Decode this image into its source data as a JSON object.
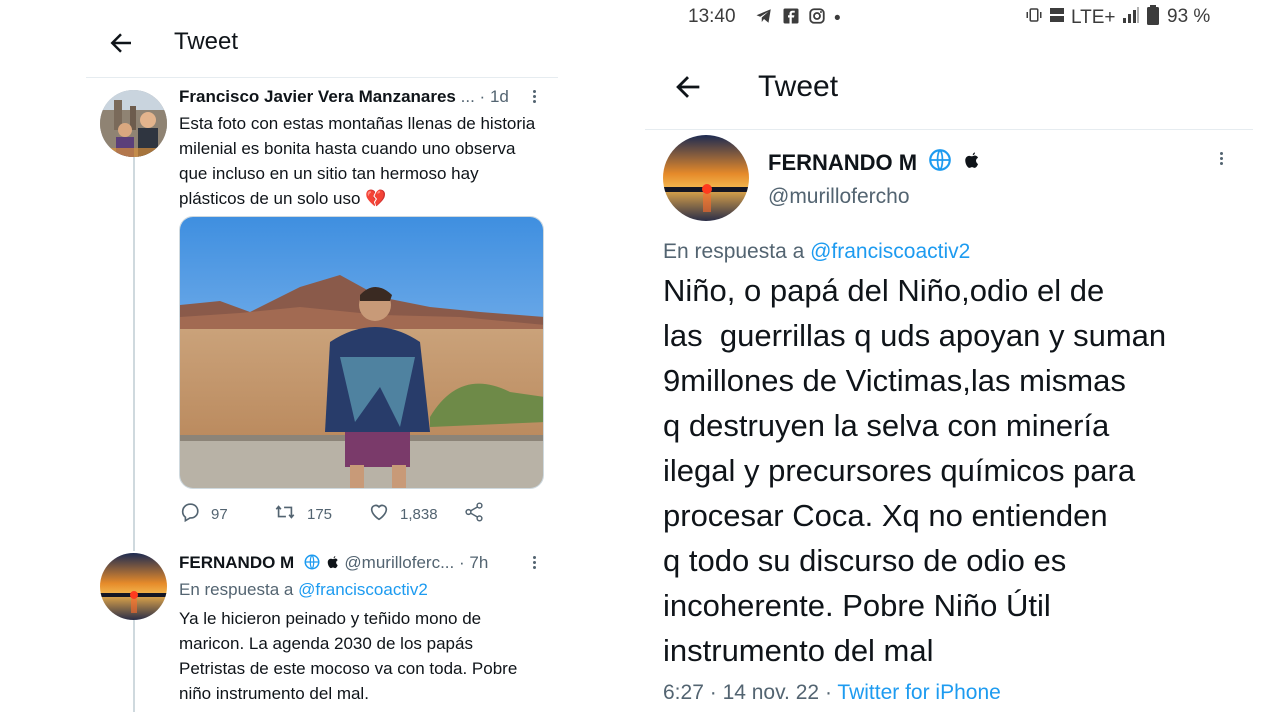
{
  "left": {
    "header": {
      "title": "Tweet"
    },
    "tweet1": {
      "name": "Francisco Javier Vera Manzanares",
      "ellipsis": "...",
      "dot": "·",
      "time": "1d",
      "text": "Esta foto con estas montañas llenas de historia milenial es bonita hasta cuando uno observa que incluso en un sitio tan hermoso hay plásticos de un solo uso 💔",
      "actions": {
        "replies": "97",
        "retweets": "175",
        "likes": "1,838"
      }
    },
    "tweet2": {
      "name": "FERNANDO M",
      "handle": "@murilloferc...",
      "dot": "·",
      "time": "7h",
      "reply_prefix": "En respuesta a",
      "reply_to": "@franciscoactiv2",
      "text": "Ya le hicieron peinado y teñido mono de maricon. La agenda 2030 de los papás Petristas de este mocoso va con toda. Pobre niño instrumento del mal."
    }
  },
  "right": {
    "status_bar": {
      "time": "13:40",
      "dot": "•",
      "network": "LTE+",
      "battery": "93 %"
    },
    "header": {
      "title": "Tweet"
    },
    "tweet": {
      "name": "FERNANDO M",
      "handle": "@murillofercho",
      "reply_prefix": "En respuesta a",
      "reply_to": "@franciscoactiv2",
      "text_lines": [
        "Niño, o papá del Niño,odio el de",
        "las  guerrillas q uds apoyan y suman",
        "9millones de Victimas,las mismas",
        "q destruyen la selva con minería",
        "ilegal y precursores químicos para",
        "procesar Coca. Xq no entienden",
        "q todo su discurso de odio es",
        "incoherente. Pobre Niño Útil",
        "instrumento del mal"
      ],
      "time": "6:27",
      "sep1": "·",
      "date": "14 nov. 22",
      "sep2": "·",
      "source": "Twitter for iPhone"
    }
  },
  "icons": {
    "back": "arrow-left-icon",
    "more": "more-vertical-icon",
    "reply": "comment-icon",
    "retweet": "retweet-icon",
    "like": "heart-icon",
    "share": "share-icon",
    "globe": "globe-icon",
    "apple": "apple-icon",
    "broken_heart": "broken-heart-icon"
  },
  "colors": {
    "link": "#1d9bf0",
    "muted": "#536471",
    "text": "#0f1419",
    "divider": "#e6ecf0"
  }
}
